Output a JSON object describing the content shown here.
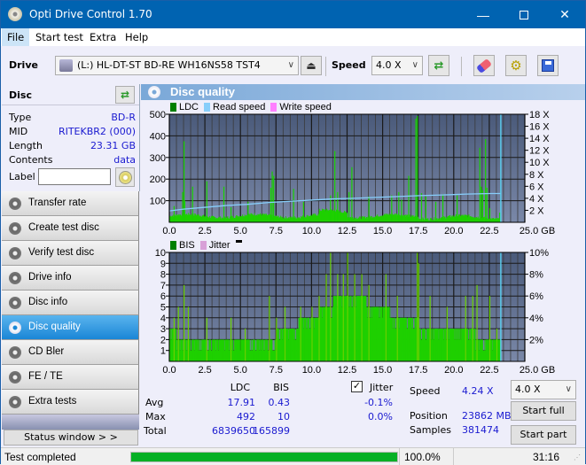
{
  "window": {
    "title": "Opti Drive Control 1.70",
    "controls": [
      "minimize",
      "maximize",
      "close"
    ]
  },
  "menu": [
    "File",
    "Start test",
    "Extra",
    "Help"
  ],
  "toolbar": {
    "drive_label": "Drive",
    "drive_value": "(L:)  HL-DT-ST BD-RE  WH16NS58 TST4",
    "speed_label": "Speed",
    "speed_value": "4.0 X",
    "icons": [
      "eject-icon",
      "refresh-icon",
      "erase-icon",
      "settings-icon",
      "save-icon"
    ]
  },
  "disc": {
    "header": "Disc",
    "rows": [
      {
        "key": "Type",
        "value": "BD-R"
      },
      {
        "key": "MID",
        "value": "RITEKBR2 (000)"
      },
      {
        "key": "Length",
        "value": "23.31 GB"
      },
      {
        "key": "Contents",
        "value": "data"
      }
    ],
    "label_key": "Label",
    "label_value": ""
  },
  "nav": [
    {
      "label": "Transfer rate",
      "active": false
    },
    {
      "label": "Create test disc",
      "active": false
    },
    {
      "label": "Verify test disc",
      "active": false
    },
    {
      "label": "Drive info",
      "active": false
    },
    {
      "label": "Disc info",
      "active": false
    },
    {
      "label": "Disc quality",
      "active": true
    },
    {
      "label": "CD Bler",
      "active": false
    },
    {
      "label": "FE / TE",
      "active": false
    },
    {
      "label": "Extra tests",
      "active": false
    }
  ],
  "status_window_button": "Status window > >",
  "panel_title": "Disc quality",
  "colors": {
    "ldc": "#008000",
    "read_speed": "#87cefa",
    "write_speed": "#ff80ff",
    "bis": "#008000",
    "jitter": "#d8a0d8",
    "bar_fill": "#1ed000",
    "plot_bg_top": "#4a5a7a",
    "plot_bg_bottom": "#7a88a8",
    "progress": "#06b025"
  },
  "chart_data": [
    {
      "type": "bar",
      "title": "LDC",
      "legend": [
        "LDC",
        "Read speed",
        "Write speed"
      ],
      "xlabel": "GB",
      "x_ticks": [
        "0.0",
        "2.5",
        "5.0",
        "7.5",
        "10.0",
        "12.5",
        "15.0",
        "17.5",
        "20.0",
        "22.5",
        "25.0 GB"
      ],
      "xlim": [
        0,
        25
      ],
      "ylim": [
        0,
        500
      ],
      "y_ticks": [
        "100",
        "200",
        "300",
        "400",
        "500"
      ],
      "y2_ticks": [
        "2 X",
        "4 X",
        "6 X",
        "8 X",
        "10 X",
        "12 X",
        "14 X",
        "16 X",
        "18 X"
      ],
      "y2lim": [
        0,
        18
      ],
      "end_marker_gb": 23.31,
      "baseline_approx": 28,
      "spikes": [
        {
          "x": 0.3,
          "y": 75
        },
        {
          "x": 0.9,
          "y": 140
        },
        {
          "x": 1.0,
          "y": 375
        },
        {
          "x": 1.05,
          "y": 100
        },
        {
          "x": 1.6,
          "y": 165
        },
        {
          "x": 2.6,
          "y": 190
        },
        {
          "x": 3.8,
          "y": 165
        },
        {
          "x": 4.3,
          "y": 70
        },
        {
          "x": 5.5,
          "y": 95
        },
        {
          "x": 7.1,
          "y": 160
        },
        {
          "x": 7.2,
          "y": 235
        },
        {
          "x": 7.3,
          "y": 215
        },
        {
          "x": 8.7,
          "y": 155
        },
        {
          "x": 9.4,
          "y": 95
        },
        {
          "x": 11.3,
          "y": 125
        },
        {
          "x": 11.6,
          "y": 330
        },
        {
          "x": 11.8,
          "y": 140
        },
        {
          "x": 12.6,
          "y": 140
        },
        {
          "x": 12.8,
          "y": 255
        },
        {
          "x": 14.0,
          "y": 120
        },
        {
          "x": 15.6,
          "y": 125
        },
        {
          "x": 16.1,
          "y": 140
        },
        {
          "x": 16.3,
          "y": 105
        },
        {
          "x": 16.8,
          "y": 215
        },
        {
          "x": 17.3,
          "y": 480
        },
        {
          "x": 17.4,
          "y": 492
        },
        {
          "x": 17.7,
          "y": 135
        },
        {
          "x": 18.0,
          "y": 120
        },
        {
          "x": 18.7,
          "y": 95
        },
        {
          "x": 19.2,
          "y": 130
        },
        {
          "x": 20.2,
          "y": 125
        },
        {
          "x": 21.8,
          "y": 345
        },
        {
          "x": 21.9,
          "y": 165
        },
        {
          "x": 22.0,
          "y": 150
        },
        {
          "x": 22.2,
          "y": 385
        },
        {
          "x": 22.3,
          "y": 160
        },
        {
          "x": 22.5,
          "y": 65
        },
        {
          "x": 23.2,
          "y": 45
        }
      ],
      "read_speed_steps": [
        {
          "x": 0.0,
          "x_speed": 1.9
        },
        {
          "x": 1.0,
          "x_speed": 2.2
        },
        {
          "x": 2.5,
          "x_speed": 2.5
        },
        {
          "x": 4.0,
          "x_speed": 2.8
        },
        {
          "x": 5.5,
          "x_speed": 3.0
        },
        {
          "x": 7.0,
          "x_speed": 3.3
        },
        {
          "x": 8.5,
          "x_speed": 3.5
        },
        {
          "x": 10.0,
          "x_speed": 3.7
        },
        {
          "x": 11.5,
          "x_speed": 3.9
        },
        {
          "x": 13.0,
          "x_speed": 4.0
        },
        {
          "x": 14.5,
          "x_speed": 4.15
        },
        {
          "x": 16.1,
          "x_speed": 4.3
        },
        {
          "x": 17.6,
          "x_speed": 4.45
        },
        {
          "x": 19.2,
          "x_speed": 4.55
        },
        {
          "x": 20.9,
          "x_speed": 4.7
        },
        {
          "x": 22.6,
          "x_speed": 4.8
        },
        {
          "x": 23.31,
          "x_speed": 4.8
        }
      ]
    },
    {
      "type": "bar",
      "title": "BIS",
      "legend": [
        "BIS",
        "Jitter"
      ],
      "xlabel": "GB",
      "x_ticks": [
        "0.0",
        "2.5",
        "5.0",
        "7.5",
        "10.0",
        "12.5",
        "15.0",
        "17.5",
        "20.0",
        "22.5",
        "25.0 GB"
      ],
      "xlim": [
        0,
        25
      ],
      "ylim": [
        0,
        10
      ],
      "y_ticks": [
        "1",
        "2",
        "3",
        "4",
        "5",
        "6",
        "7",
        "8",
        "9",
        "10"
      ],
      "y2_ticks": [
        "2%",
        "4%",
        "6%",
        "8%",
        "10%"
      ],
      "y2lim": [
        0,
        10
      ],
      "end_marker_gb": 23.31,
      "level_profile": [
        {
          "from": 0.0,
          "to": 0.5,
          "level": 3
        },
        {
          "from": 0.5,
          "to": 2.5,
          "level": 2
        },
        {
          "from": 2.5,
          "to": 5.3,
          "level": 2
        },
        {
          "from": 5.3,
          "to": 7.5,
          "level": 2
        },
        {
          "from": 7.5,
          "to": 9.0,
          "level": 3
        },
        {
          "from": 9.0,
          "to": 10.5,
          "level": 4
        },
        {
          "from": 10.5,
          "to": 11.5,
          "level": 5
        },
        {
          "from": 11.5,
          "to": 13.8,
          "level": 6
        },
        {
          "from": 13.8,
          "to": 15.5,
          "level": 5
        },
        {
          "from": 15.5,
          "to": 17.5,
          "level": 4
        },
        {
          "from": 17.5,
          "to": 19.5,
          "level": 3
        },
        {
          "from": 19.5,
          "to": 21.5,
          "level": 3
        },
        {
          "from": 21.5,
          "to": 23.31,
          "level": 2
        }
      ],
      "spikes": [
        {
          "x": 0.3,
          "y": 4
        },
        {
          "x": 0.6,
          "y": 5
        },
        {
          "x": 1.0,
          "y": 7
        },
        {
          "x": 1.3,
          "y": 5
        },
        {
          "x": 2.6,
          "y": 4
        },
        {
          "x": 4.3,
          "y": 4
        },
        {
          "x": 5.3,
          "y": 3
        },
        {
          "x": 7.0,
          "y": 6
        },
        {
          "x": 7.5,
          "y": 4
        },
        {
          "x": 8.1,
          "y": 5
        },
        {
          "x": 9.2,
          "y": 5
        },
        {
          "x": 10.0,
          "y": 5
        },
        {
          "x": 10.5,
          "y": 6
        },
        {
          "x": 11.0,
          "y": 8
        },
        {
          "x": 11.3,
          "y": 10
        },
        {
          "x": 11.8,
          "y": 8
        },
        {
          "x": 12.2,
          "y": 8
        },
        {
          "x": 12.5,
          "y": 10
        },
        {
          "x": 13.0,
          "y": 8
        },
        {
          "x": 13.5,
          "y": 8
        },
        {
          "x": 14.0,
          "y": 7
        },
        {
          "x": 15.2,
          "y": 8
        },
        {
          "x": 16.0,
          "y": 6
        },
        {
          "x": 17.4,
          "y": 10
        },
        {
          "x": 17.5,
          "y": 9
        },
        {
          "x": 18.3,
          "y": 6
        },
        {
          "x": 19.5,
          "y": 5
        },
        {
          "x": 20.8,
          "y": 6
        },
        {
          "x": 21.3,
          "y": 6
        },
        {
          "x": 21.6,
          "y": 7
        },
        {
          "x": 22.5,
          "y": 6
        },
        {
          "x": 23.0,
          "y": 3
        }
      ]
    }
  ],
  "stats": {
    "col_ldc": "LDC",
    "col_bis": "BIS",
    "rows": [
      {
        "label": "Avg",
        "ldc": "17.91",
        "bis": "0.43",
        "jitter": "-0.1%"
      },
      {
        "label": "Max",
        "ldc": "492",
        "bis": "10",
        "jitter": "0.0%"
      },
      {
        "label": "Total",
        "ldc": "6839650",
        "bis": "165899",
        "jitter": ""
      }
    ],
    "jitter_label": "Jitter",
    "jitter_checked": true,
    "speed_label": "Speed",
    "speed_value": "4.24 X",
    "position_label": "Position",
    "position_value": "23862 MB",
    "samples_label": "Samples",
    "samples_value": "381474",
    "speed_select": "4.0 X",
    "start_full": "Start full",
    "start_part": "Start part"
  },
  "statusbar": {
    "text": "Test completed",
    "progress_percent": 100.0,
    "progress_label": "100.0%",
    "time": "31:16"
  }
}
